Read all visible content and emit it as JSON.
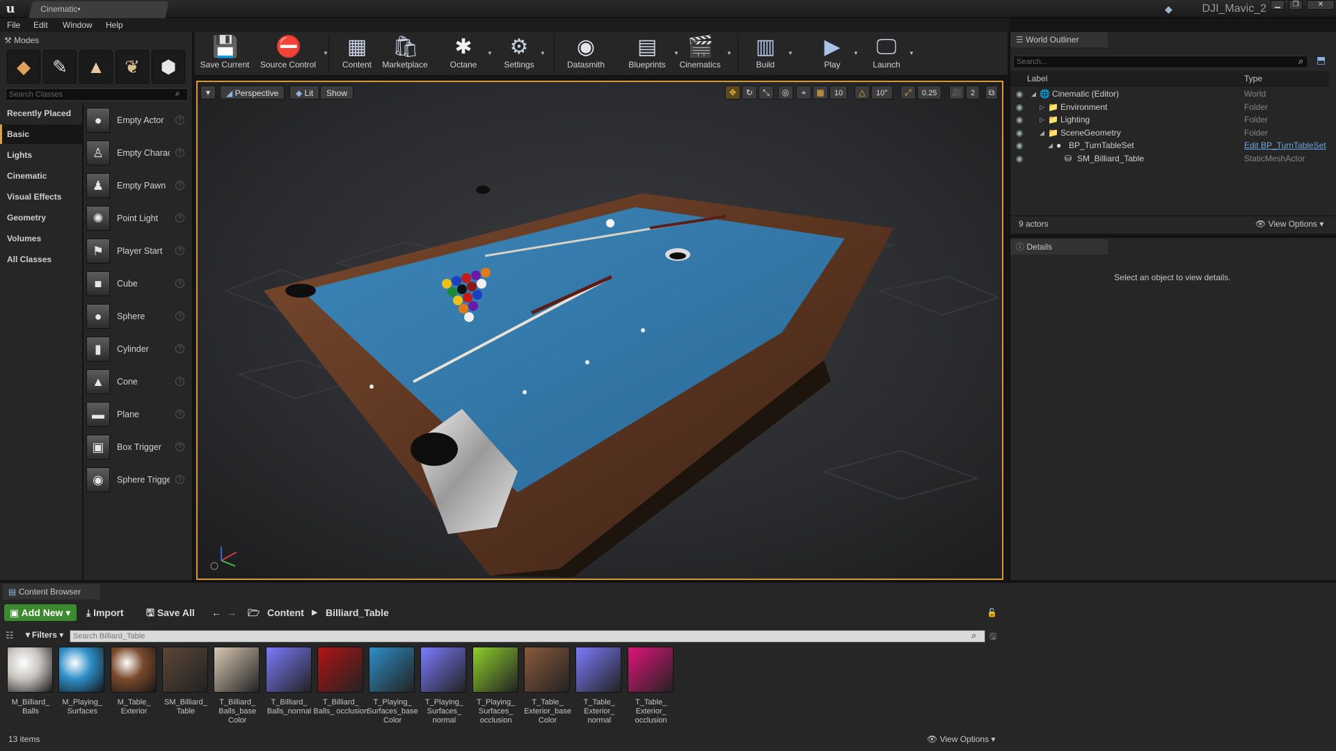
{
  "title_bar": {
    "tab_label": "Cinematic•",
    "project_name": "DJI_Mavic_2",
    "window_buttons": [
      "▁",
      "❐",
      "✕"
    ]
  },
  "menu": [
    "File",
    "Edit",
    "Window",
    "Help"
  ],
  "modes": {
    "tab_label": "Modes",
    "mode_icons": [
      "place-mode-icon",
      "paint-mode-icon",
      "landscape-mode-icon",
      "foliage-mode-icon",
      "geometry-mode-icon"
    ],
    "search_placeholder": "Search Classes",
    "categories": [
      "Recently Placed",
      "Basic",
      "Lights",
      "Cinematic",
      "Visual Effects",
      "Geometry",
      "Volumes",
      "All Classes"
    ],
    "active_category": "Basic",
    "items": [
      {
        "label": "Empty Actor",
        "icon": "●"
      },
      {
        "label": "Empty Charac",
        "icon": "♙"
      },
      {
        "label": "Empty Pawn",
        "icon": "♟"
      },
      {
        "label": "Point Light",
        "icon": "✺"
      },
      {
        "label": "Player Start",
        "icon": "⚑"
      },
      {
        "label": "Cube",
        "icon": "■"
      },
      {
        "label": "Sphere",
        "icon": "●"
      },
      {
        "label": "Cylinder",
        "icon": "▮"
      },
      {
        "label": "Cone",
        "icon": "▲"
      },
      {
        "label": "Plane",
        "icon": "▬"
      },
      {
        "label": "Box Trigger",
        "icon": "▣"
      },
      {
        "label": "Sphere Trigge",
        "icon": "◉"
      }
    ]
  },
  "toolbar": {
    "buttons": [
      {
        "label": "Save Current",
        "icon": "💾"
      },
      {
        "label": "Source Control",
        "icon": "⛔"
      },
      {
        "label": "Content",
        "icon": "▦"
      },
      {
        "label": "Marketplace",
        "icon": "🛍"
      },
      {
        "label": "Octane",
        "icon": "✱"
      },
      {
        "label": "Settings",
        "icon": "⚙"
      },
      {
        "label": "Datasmith",
        "icon": "◉"
      },
      {
        "label": "Blueprints",
        "icon": "▤"
      },
      {
        "label": "Cinematics",
        "icon": "🎬"
      },
      {
        "label": "Build",
        "icon": "▥"
      },
      {
        "label": "Play",
        "icon": "▶"
      },
      {
        "label": "Launch",
        "icon": "🖵"
      }
    ]
  },
  "viewport": {
    "perspective_label": "Perspective",
    "lit_label": "Lit",
    "show_label": "Show",
    "grid_snap": "10",
    "rotation_snap": "10°",
    "scale_snap": "0.25",
    "camera_speed": "2"
  },
  "outliner": {
    "tab_label": "World Outliner",
    "search_placeholder": "Search...",
    "col_label": "Label",
    "col_type": "Type",
    "rows": [
      {
        "label": "Cinematic (Editor)",
        "type": "World"
      },
      {
        "label": "Environment",
        "type": "Folder"
      },
      {
        "label": "Lighting",
        "type": "Folder"
      },
      {
        "label": "SceneGeometry",
        "type": "Folder"
      },
      {
        "label": "BP_TurnTableSet",
        "type": "Edit BP_TurnTableSet"
      },
      {
        "label": "SM_Billiard_Table",
        "type": "StaticMeshActor"
      }
    ],
    "actor_count": "9 actors",
    "view_options": "View Options"
  },
  "details": {
    "tab_label": "Details",
    "empty_message": "Select an object to view details."
  },
  "content_browser": {
    "tab_label": "Content Browser",
    "add_new": "Add New",
    "import": "Import",
    "save_all": "Save All",
    "path": [
      "Content",
      "Billiard_Table"
    ],
    "filters": "Filters",
    "search_placeholder": "Search Billiard_Table",
    "assets": [
      {
        "label": "M_Billiard_ Balls",
        "color": "#c9c4c0"
      },
      {
        "label": "M_Playing_ Surfaces",
        "color": "#2d8fc7"
      },
      {
        "label": "M_Table_ Exterior",
        "color": "#7a4a2c"
      },
      {
        "label": "SM_Billiard_ Table",
        "color": "#5b4637"
      },
      {
        "label": "T_Billiard_ Balls_base Color",
        "color": "#d9c9b3"
      },
      {
        "label": "T_Billiard_ Balls_normal",
        "color": "#7b7bff"
      },
      {
        "label": "T_Billiard_ Balls_ occlusion",
        "color": "#b01414"
      },
      {
        "label": "T_Playing_ Surfaces_base Color",
        "color": "#2d8fc7"
      },
      {
        "label": "T_Playing_ Surfaces_ normal",
        "color": "#7b7bff"
      },
      {
        "label": "T_Playing_ Surfaces_ occlusion",
        "color": "#8fcf2b"
      },
      {
        "label": "T_Table_ Exterior_base Color",
        "color": "#8a5a3a"
      },
      {
        "label": "T_Table_ Exterior_ normal",
        "color": "#7b7bff"
      },
      {
        "label": "T_Table_ Exterior_ occlusion",
        "color": "#e0147a"
      }
    ],
    "item_count": "13 items",
    "view_options": "View Options"
  }
}
